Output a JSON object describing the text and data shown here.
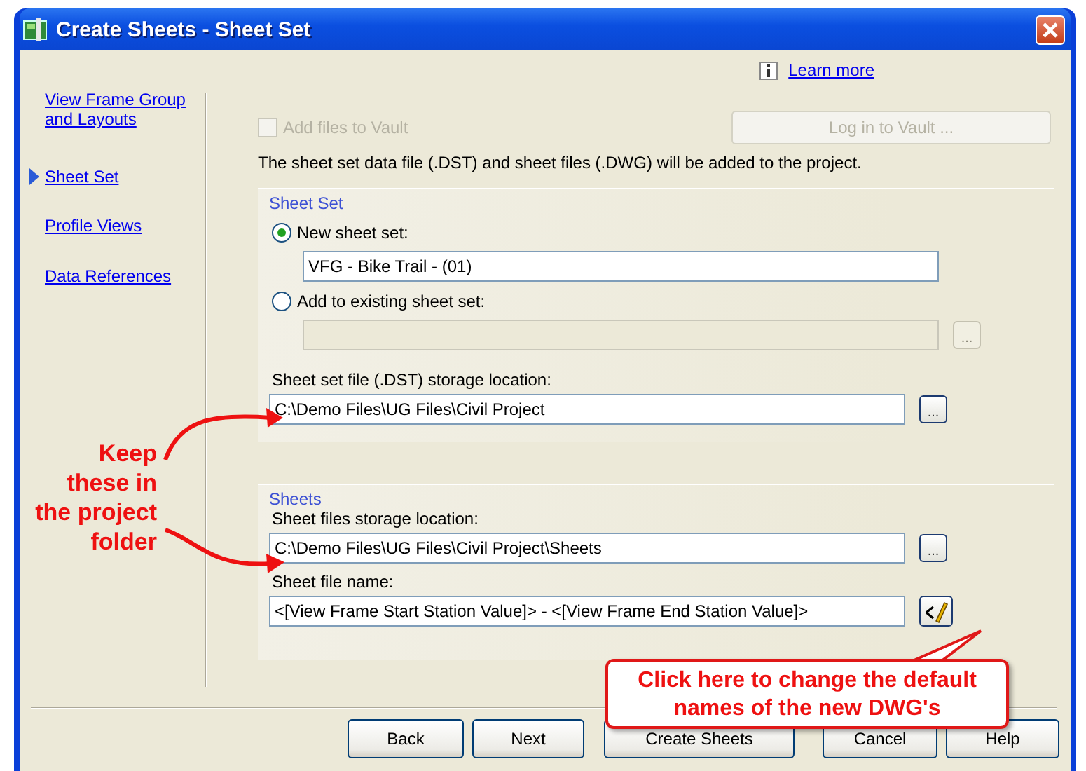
{
  "window": {
    "title": "Create Sheets - Sheet Set"
  },
  "help_link": {
    "label": "Learn more"
  },
  "nav": {
    "items": [
      {
        "label": "View Frame Group and Layouts",
        "selected": false
      },
      {
        "label": "Sheet Set",
        "selected": true
      },
      {
        "label": "Profile Views",
        "selected": false
      },
      {
        "label": "Data References",
        "selected": false
      }
    ]
  },
  "vault": {
    "checkbox": {
      "label": "Add files to Vault",
      "checked": false,
      "disabled": true
    },
    "login_button": {
      "label": "Log in to Vault ...",
      "disabled": true
    }
  },
  "description": "The sheet set data file (.DST) and sheet files (.DWG) will be added to the project.",
  "sheet_set_group": {
    "title": "Sheet Set",
    "options": [
      {
        "label": "New sheet set:",
        "selected": true,
        "value": "VFG - Bike Trail - (01)"
      },
      {
        "label": "Add to existing sheet set:",
        "selected": false,
        "browse": "..."
      }
    ],
    "storage": {
      "label": "Sheet set file (.DST) storage location:",
      "value": "C:\\Demo Files\\UG Files\\Civil Project",
      "browse": "..."
    }
  },
  "sheets_group": {
    "title": "Sheets",
    "storage": {
      "label": "Sheet files storage location:",
      "value": "C:\\Demo Files\\UG Files\\Civil Project\\Sheets",
      "browse": "..."
    },
    "file_name": {
      "label": "Sheet file name:",
      "value": "<[View Frame Start Station Value]> - <[View Frame End Station Value]>"
    }
  },
  "buttons": [
    {
      "label": "Back"
    },
    {
      "label": "Next"
    },
    {
      "label": "Create Sheets"
    },
    {
      "label": "Cancel"
    },
    {
      "label": "Help"
    }
  ],
  "annotations": [
    {
      "kind": "note",
      "text": "Keep\nthese in\nthe project\nfolder"
    },
    {
      "kind": "callout",
      "text": "Click here to change the default names of the new DWG's"
    }
  ]
}
